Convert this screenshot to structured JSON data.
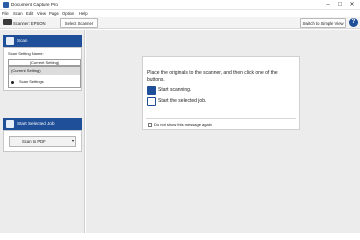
{
  "window": {
    "title": "Document Capture Pro",
    "controls": [
      "–",
      "☐",
      "✕"
    ]
  },
  "menu": [
    "File",
    "Scan",
    "Edit",
    "View",
    "Page",
    "Option",
    "Help"
  ],
  "toolbar": {
    "scanner_label": "Scanner: EPSON",
    "select_scanner": "Select Scanner",
    "switch_simple": "Switch to Simple View",
    "help": "?"
  },
  "left": {
    "scan_header": "Scan",
    "setting_name_label": "Scan Setting Name:",
    "selected_setting": "(Current Setting)",
    "options": [
      "(Current Setting)",
      "Scan Settings"
    ],
    "job_header": "Start Selected Job",
    "job_button": "Scan to PDF"
  },
  "main": {
    "line1": "Place the originals to the scanner, and then click one of the",
    "line2": "buttons.",
    "start_scanning": "Start scanning.",
    "start_job": "Start the selected job.",
    "dont_show": "Do not show this message again"
  },
  "colors": {
    "accent": "#1f4f98"
  }
}
